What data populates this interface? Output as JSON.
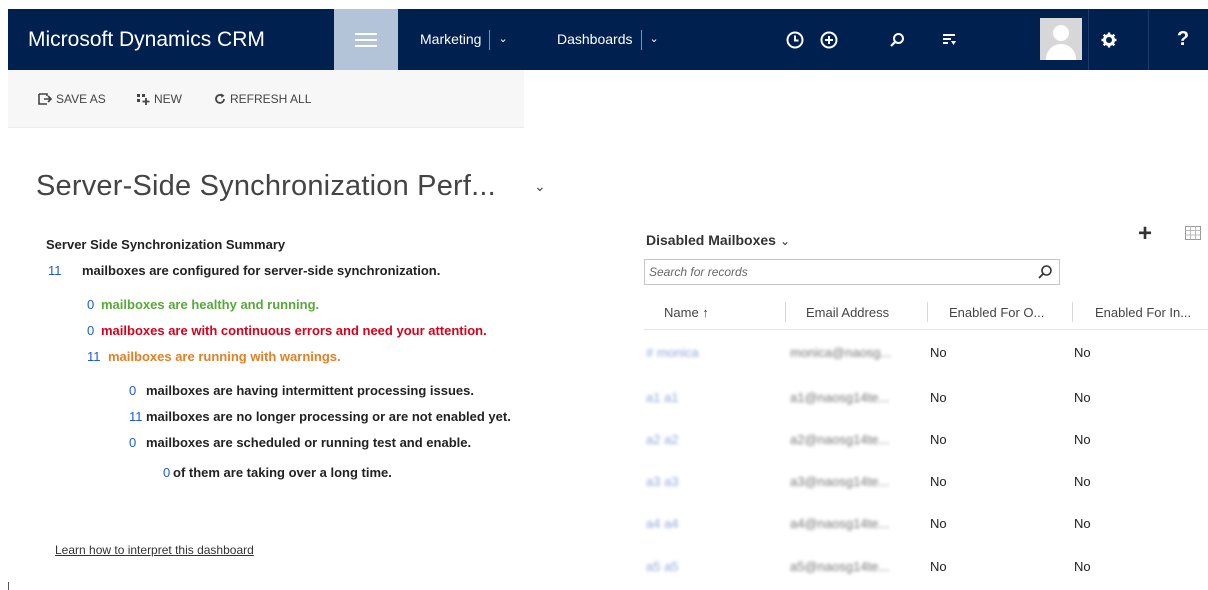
{
  "header": {
    "brand": "Microsoft Dynamics CRM",
    "nav": [
      {
        "label": "Marketing",
        "chevron": "⌄"
      },
      {
        "label": "Dashboards",
        "chevron": "⌄"
      }
    ],
    "icons": [
      "history-icon",
      "create-icon",
      "search-icon",
      "advanced-find-icon",
      "user-avatar",
      "settings-icon",
      "help-icon"
    ],
    "help_glyph": "?",
    "colors": {
      "bar": "#002050",
      "hamburger": "#b4c4d8"
    }
  },
  "commands": {
    "save_as": "SAVE AS",
    "new": "NEW",
    "refresh_all": "REFRESH ALL"
  },
  "page": {
    "title": "Server-Side Synchronization Perf...",
    "title_chevron": "⌄"
  },
  "summary": {
    "heading": "Server Side Synchronization Summary",
    "lines": [
      {
        "num": "11",
        "text": "mailboxes are configured for server-side synchronization."
      },
      {
        "num": "0",
        "text": "mailboxes are healthy and running."
      },
      {
        "num": "0",
        "text": "mailboxes are with continuous errors and need your attention."
      },
      {
        "num": "11",
        "text": "mailboxes are running with warnings."
      },
      {
        "num": "0",
        "text": "mailboxes are having intermittent processing issues."
      },
      {
        "num": "11",
        "text": "mailboxes are no longer processing or are not enabled yet."
      },
      {
        "num": "0",
        "text": "mailboxes are scheduled or running test and enable."
      },
      {
        "num": "0",
        "text": "of them are taking over a long time."
      }
    ],
    "learn_link": "Learn how to interpret this dashboard"
  },
  "grid": {
    "title": "Disabled Mailboxes",
    "title_chevron": "⌄",
    "add_glyph": "+",
    "search_placeholder": "Search for records",
    "columns": [
      "Name ↑",
      "Email Address",
      "Enabled For O...",
      "Enabled For In..."
    ],
    "rows": [
      {
        "name": "# monica",
        "email": "monica@naosg...",
        "outgoing": "No",
        "incoming": "No"
      },
      {
        "name": "a1 a1",
        "email": "a1@naosg14te...",
        "outgoing": "No",
        "incoming": "No"
      },
      {
        "name": "a2 a2",
        "email": "a2@naosg14te...",
        "outgoing": "No",
        "incoming": "No"
      },
      {
        "name": "a3 a3",
        "email": "a3@naosg14te...",
        "outgoing": "No",
        "incoming": "No"
      },
      {
        "name": "a4 a4",
        "email": "a4@naosg14te...",
        "outgoing": "No",
        "incoming": "No"
      },
      {
        "name": "a5 a5",
        "email": "a5@naosg14te...",
        "outgoing": "No",
        "incoming": "No"
      }
    ]
  }
}
